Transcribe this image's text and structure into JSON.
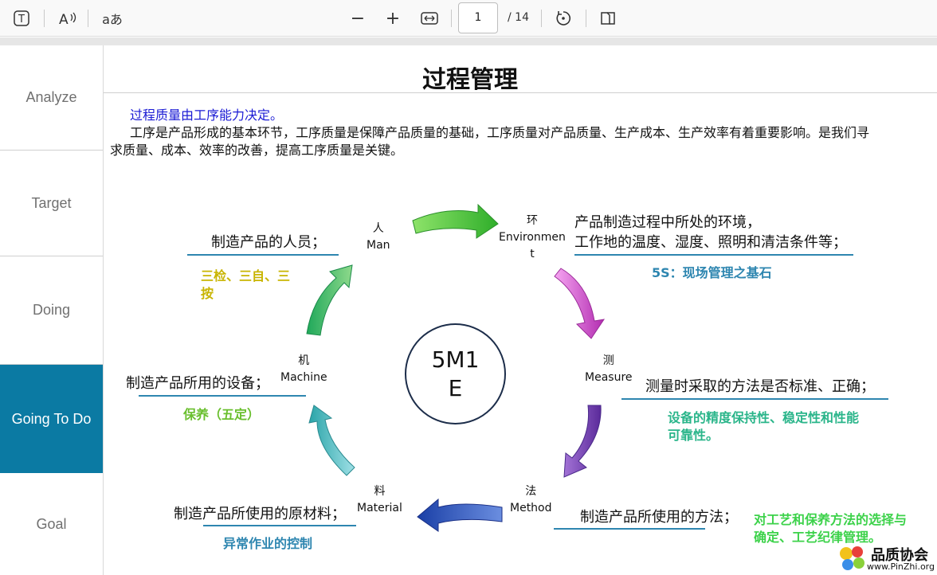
{
  "toolbar": {
    "icons": [
      "text-icon",
      "read-aloud-icon",
      "translate-icon",
      "zoom-out-icon",
      "zoom-in-icon",
      "fit-width-icon",
      "rotate-icon",
      "two-page-icon"
    ],
    "text_tool": "T",
    "read_aloud": "A",
    "translate": "aあ",
    "zoom_out": "−",
    "zoom_in": "+",
    "current_page": "1",
    "total_pages": "/ 14"
  },
  "sidebar": {
    "items": [
      {
        "label": "Analyze",
        "active": false
      },
      {
        "label": "Target",
        "active": false
      },
      {
        "label": "Doing",
        "active": false
      },
      {
        "label": "Going To Do",
        "active": true
      },
      {
        "label": "Goal",
        "active": false
      }
    ]
  },
  "slide": {
    "title": "过程管理",
    "intro_blue": "过程质量由工序能力决定。",
    "intro_line1": "工序是产品形成的基本环节，工序质量是保障产品质量的基础，工序质量对产品质量、生产成本、生产效率有着重要影响。是我们寻",
    "intro_line2": "求质量、成本、效率的改善，提高工序质量是关键。",
    "center": {
      "line1": "5M1",
      "line2": "E"
    },
    "man": {
      "cn": "人",
      "en": "Man",
      "desc": "制造产品的人员；",
      "note": "三检、三自、三",
      "note2": "按"
    },
    "environment": {
      "cn": "环",
      "en1": "Environmen",
      "en2": "t",
      "desc1": "产品制造过程中所处的环境，",
      "desc2": "工作地的温度、湿度、照明和清洁条件等；",
      "note": "5S：现场管理之基石"
    },
    "measure": {
      "cn": "测",
      "en": "Measure",
      "desc": "测量时采取的方法是否标准、正确；",
      "note1": "设备的精度保持性、稳定性和性能",
      "note2": "可靠性。"
    },
    "method": {
      "cn": "法",
      "en": "Method",
      "desc": "制造产品所使用的方法；",
      "note1": "对工艺和保养方法的选择与",
      "note2": "确定、工艺纪律管理。"
    },
    "material": {
      "cn": "料",
      "en": "Material",
      "desc": "制造产品所使用的原材料；",
      "note": "异常作业的控制"
    },
    "machine": {
      "cn": "机",
      "en": "Machine",
      "desc": "制造产品所用的设备；",
      "note": "保养（五定）"
    },
    "colors": {
      "man_note": "#c8b400",
      "env_note": "#2e86b0",
      "measure_note": "#2ab58a",
      "method_note": "#3cd24a",
      "material_note": "#2e86b0",
      "machine_note": "#6abf2e"
    },
    "logo": {
      "cn": "品质协会",
      "url": "www.PinZhi.org"
    }
  }
}
